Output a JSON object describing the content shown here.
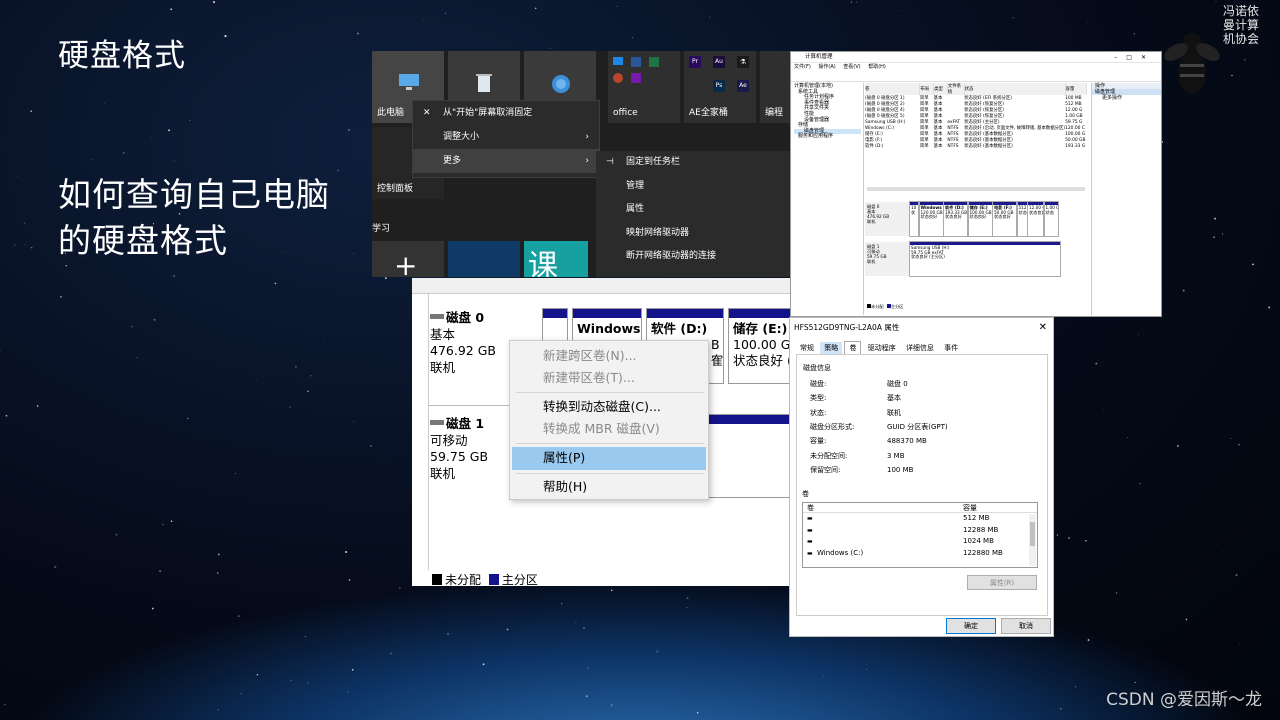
{
  "slide": {
    "title": "硬盘格式",
    "subtitle": "如何查询自己电脑的硬盘格式",
    "badge_text": "冯诺依曼计算机协会",
    "watermark": "CSDN @爱因斯～龙"
  },
  "start_menu": {
    "tiles": [
      "此电脑",
      "office",
      "AE全家桶",
      "编程",
      "控制面板"
    ],
    "section_label": "学习",
    "context_menu": [
      "从\"开始\"屏幕取消固定",
      "调整大小",
      "更多"
    ],
    "submenu": [
      "固定到任务栏",
      "管理",
      "属性",
      "映射网络驱动器",
      "断开网络驱动器的连接"
    ]
  },
  "computer_management": {
    "window_title": "计算机管理",
    "menu": [
      "文件(F)",
      "操作(A)",
      "查看(V)",
      "帮助(H)"
    ],
    "tree": [
      "计算机管理(本地)",
      "系统工具",
      "任务计划程序",
      "事件查看器",
      "共享文件夹",
      "性能",
      "设备管理器",
      "存储",
      "磁盘管理",
      "服务和应用程序"
    ],
    "columns": [
      "卷",
      "布局",
      "类型",
      "文件系统",
      "状态",
      "容量"
    ],
    "volumes": [
      [
        "(磁盘 0 磁盘分区 1)",
        "简单",
        "基本",
        "",
        "状态良好 (EFI 系统分区)",
        "100 MB"
      ],
      [
        "(磁盘 0 磁盘分区 2)",
        "简单",
        "基本",
        "",
        "状态良好 (恢复分区)",
        "512 MB"
      ],
      [
        "(磁盘 0 磁盘分区 4)",
        "简单",
        "基本",
        "",
        "状态良好 (恢复分区)",
        "12.00 G"
      ],
      [
        "(磁盘 0 磁盘分区 5)",
        "简单",
        "基本",
        "",
        "状态良好 (恢复分区)",
        "1.00 GB"
      ],
      [
        "Samsung USB (H:)",
        "简单",
        "基本",
        "exFAT",
        "状态良好 (主分区)",
        "59.75 G"
      ],
      [
        "Windows (C:)",
        "简单",
        "基本",
        "NTFS",
        "状态良好 (启动, 页面文件, 故障转储, 基本数据分区)",
        "120.00 C"
      ],
      [
        "储存 (E:)",
        "简单",
        "基本",
        "NTFS",
        "状态良好 (基本数据分区)",
        "100.00 G"
      ],
      [
        "电影 (F:)",
        "简单",
        "基本",
        "NTFS",
        "状态良好 (基本数据分区)",
        "50.00 GB"
      ],
      [
        "软件 (D:)",
        "简单",
        "基本",
        "NTFS",
        "状态良好 (基本数据分区)",
        "193.33 G"
      ]
    ],
    "actions_header": "操作",
    "actions_section": "磁盘管理",
    "actions_more": "更多操作",
    "disk0": {
      "name": "磁盘 0",
      "type": "基本",
      "size": "476.92 GB",
      "status": "联机"
    },
    "disk0_parts": [
      {
        "name": "",
        "size": "10",
        "status": "状"
      },
      {
        "name": "Windows",
        "size": "120.00 GB",
        "status": "状态良好"
      },
      {
        "name": "软件 (D:)",
        "size": "193.33 GB",
        "status": "状态良好"
      },
      {
        "name": "储存 (E:)",
        "size": "100.00 GB",
        "status": "状态良好"
      },
      {
        "name": "电影 (F:)",
        "size": "50.00 GB",
        "status": "状态良好"
      },
      {
        "name": "",
        "size": "512",
        "status": "状态"
      },
      {
        "name": "",
        "size": "12.00 GB",
        "status": "状态良好"
      },
      {
        "name": "",
        "size": "1.00 G",
        "status": "状态"
      }
    ],
    "disk1": {
      "name": "磁盘 1",
      "type": "可移动",
      "size": "59.75 GB",
      "status": "联机"
    },
    "disk1_part": {
      "name": "Samsung USB (H:)",
      "size": "59.75 GB exFAT",
      "status": "状态良好 (主分区)"
    },
    "legend": [
      "未分配",
      "主分区"
    ]
  },
  "disk_zoom": {
    "disk0": {
      "name": "磁盘 0",
      "type": "基本",
      "size": "476.92 GB",
      "status": "联机"
    },
    "disk1": {
      "name": "磁盘 1",
      "type": "可移动",
      "size": "59.75 GB",
      "status": "联机"
    },
    "parts": [
      {
        "name": "Windows",
        "size": "",
        "status": ""
      },
      {
        "name": "软件 (D:)",
        "size": "B",
        "status": "隺"
      },
      {
        "name": "储存 (E:)",
        "size": "100.00 GB",
        "status": "状态良好 ("
      }
    ],
    "menu": [
      "新建跨区卷(N)...",
      "新建带区卷(T)...",
      "转换到动态磁盘(C)...",
      "转换成 MBR 磁盘(V)",
      "属性(P)",
      "帮助(H)"
    ],
    "legend": [
      "未分配",
      "主分区"
    ]
  },
  "properties": {
    "title": "HFS512GD9TNG-L2A0A 属性",
    "tabs": [
      "常规",
      "策略",
      "卷",
      "驱动程序",
      "详细信息",
      "事件"
    ],
    "active_tab": "卷",
    "section": "磁盘信息",
    "rows": [
      {
        "k": "磁盘:",
        "v": "磁盘 0"
      },
      {
        "k": "类型:",
        "v": "基本"
      },
      {
        "k": "状态:",
        "v": "联机"
      },
      {
        "k": "磁盘分区形式:",
        "v": "GUID 分区表(GPT)"
      },
      {
        "k": "容量:",
        "v": "488370 MB"
      },
      {
        "k": "未分配空间:",
        "v": "3 MB"
      },
      {
        "k": "保留空间:",
        "v": "100 MB"
      }
    ],
    "volumes_label": "卷",
    "vol_columns": [
      "卷",
      "容量"
    ],
    "volumes": [
      {
        "name": "",
        "cap": "512 MB"
      },
      {
        "name": "",
        "cap": "12288 MB"
      },
      {
        "name": "",
        "cap": "1024 MB"
      },
      {
        "name": "Windows (C:)",
        "cap": "122880 MB"
      }
    ],
    "props_button": "属性(R)",
    "ok": "确定",
    "cancel": "取消"
  },
  "colors": {
    "partition_bar": "#13138c",
    "highlight": "#99c9ef",
    "tile_purple": "#6b2fa2"
  }
}
